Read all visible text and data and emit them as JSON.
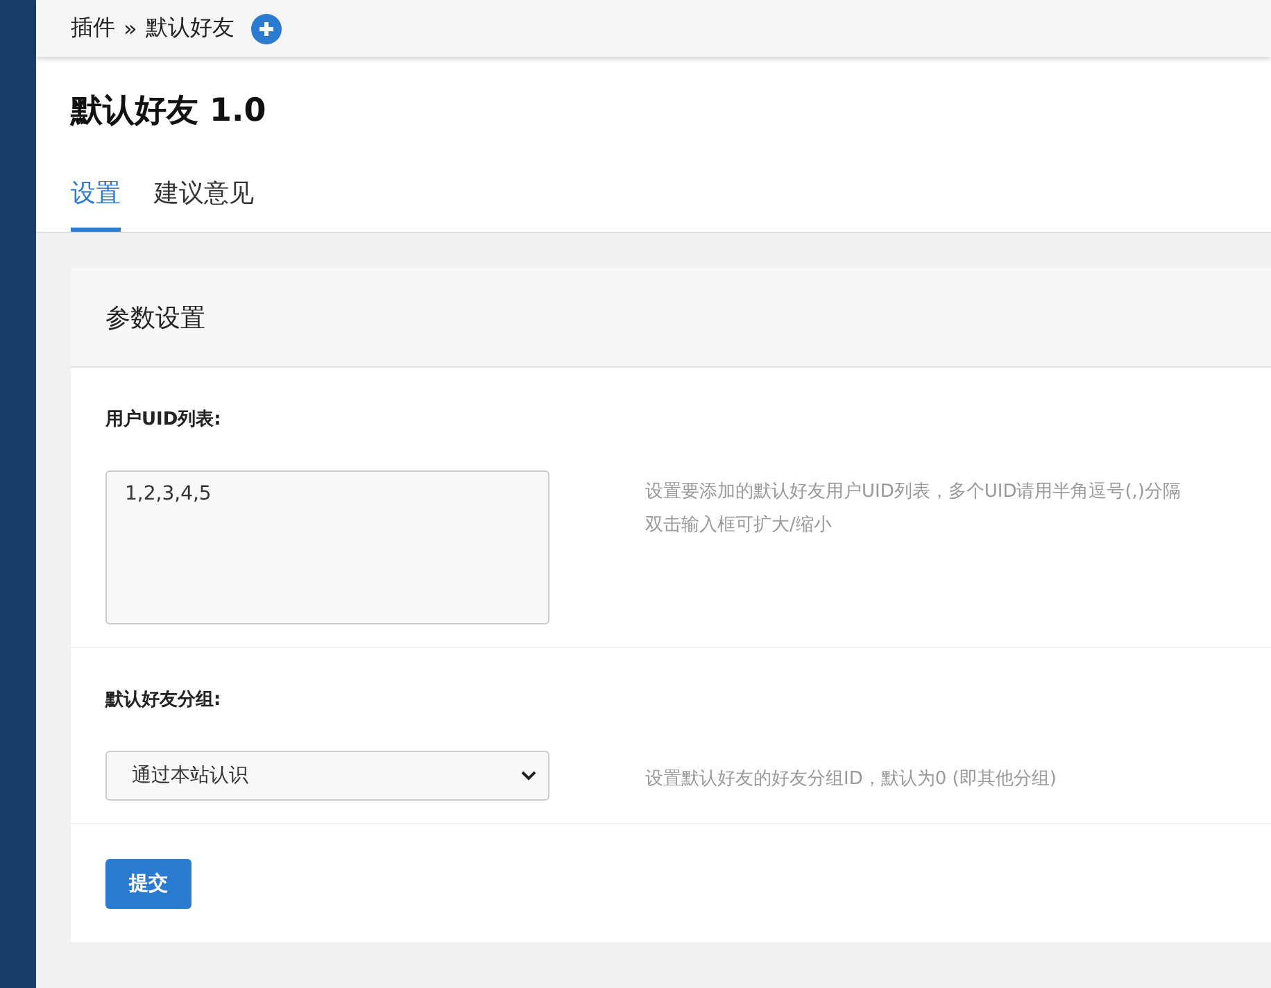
{
  "breadcrumb": {
    "parent": "插件",
    "separator": "»",
    "current": "默认好友"
  },
  "title": "默认好友 1.0",
  "tabs": [
    {
      "label": "设置",
      "selected": true
    },
    {
      "label": "建议意见",
      "selected": false
    }
  ],
  "panel": {
    "title": "参数设置",
    "fields": [
      {
        "kind": "textarea",
        "label": "用户UID列表:",
        "value": "1,2,3,4,5",
        "help": [
          "设置要添加的默认好友用户UID列表，多个UID请用半角逗号(,)分隔",
          "双击输入框可扩大/缩小"
        ]
      },
      {
        "kind": "select",
        "label": "默认好友分组:",
        "value": "通过本站认识",
        "help": [
          "设置默认好友的好友分组ID，默认为0 (即其他分组)"
        ]
      }
    ],
    "submit": "提交"
  }
}
